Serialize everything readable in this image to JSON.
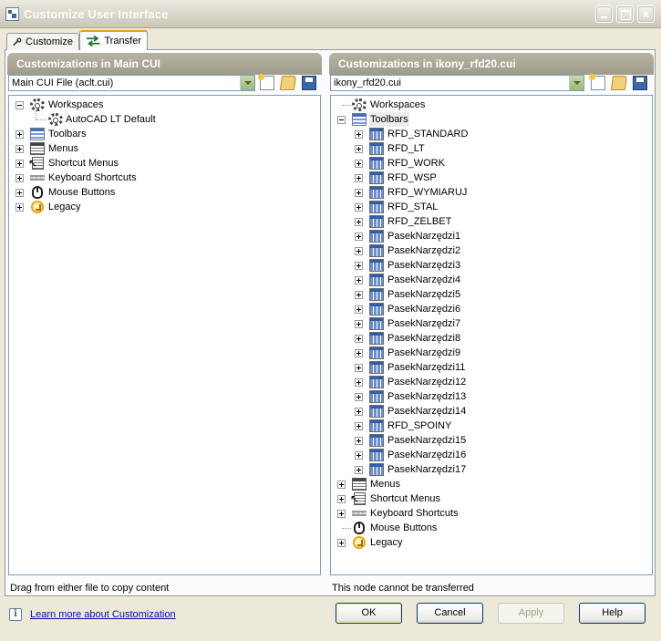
{
  "window": {
    "title": "Customize User Interface",
    "controls": {
      "minimize": "minimize",
      "maximize": "maximize",
      "close": "×"
    }
  },
  "tabs": [
    {
      "label": "Customize",
      "icon": "wrench-icon",
      "active": false
    },
    {
      "label": "Transfer",
      "icon": "transfer-arrows-icon",
      "active": true
    }
  ],
  "left_panel": {
    "header": "Customizations in Main CUI",
    "combo_value": "Main CUI File (aclt.cui)",
    "status": "Drag from either file to copy content",
    "tree": [
      {
        "label": "Workspaces",
        "icon": "workspaces-gear-icon",
        "expander": "minus",
        "level": 0,
        "children": [
          {
            "label": "AutoCAD LT Default",
            "icon": "workspace-gear-icon",
            "level": 1
          }
        ]
      },
      {
        "label": "Toolbars",
        "icon": "toolbars-icon",
        "expander": "plus",
        "level": 0
      },
      {
        "label": "Menus",
        "icon": "menus-icon",
        "expander": "plus",
        "level": 0
      },
      {
        "label": "Shortcut Menus",
        "icon": "shortcut-menus-icon",
        "expander": "plus",
        "level": 0
      },
      {
        "label": "Keyboard Shortcuts",
        "icon": "keyboard-icon",
        "expander": "plus",
        "level": 0
      },
      {
        "label": "Mouse Buttons",
        "icon": "mouse-icon",
        "expander": "plus",
        "level": 0
      },
      {
        "label": "Legacy",
        "icon": "legacy-icon",
        "expander": "plus",
        "level": 0
      }
    ]
  },
  "right_panel": {
    "header": "Customizations in ikony_rfd20.cui",
    "combo_value": "ikony_rfd20.cui",
    "status": "This node cannot be transferred",
    "tree": {
      "workspaces": "Workspaces",
      "toolbars": "Toolbars",
      "toolbar_items": [
        "RFD_STANDARD",
        "RFD_LT",
        "RFD_WORK",
        "RFD_WSP",
        "RFD_WYMIARUJ",
        "RFD_STAL",
        "RFD_ZELBET",
        "PasekNarzędzi1",
        "PasekNarzędzi2",
        "PasekNarzędzi3",
        "PasekNarzędzi4",
        "PasekNarzędzi5",
        "PasekNarzędzi6",
        "PasekNarzędzi7",
        "PasekNarzędzi8",
        "PasekNarzędzi9",
        "PasekNarzędzi11",
        "PasekNarzędzi12",
        "PasekNarzędzi13",
        "PasekNarzędzi14",
        "RFD_SPOINY",
        "PasekNarzędzi15",
        "PasekNarzędzi16",
        "PasekNarzędzi17"
      ],
      "menus": "Menus",
      "shortcut_menus": "Shortcut Menus",
      "keyboard_shortcuts": "Keyboard Shortcuts",
      "mouse_buttons": "Mouse Buttons",
      "legacy": "Legacy"
    }
  },
  "footer": {
    "info_icon": "i",
    "learn_link": "Learn more about Customization",
    "buttons": {
      "ok": "OK",
      "cancel": "Cancel",
      "apply": "Apply",
      "help": "Help"
    }
  }
}
